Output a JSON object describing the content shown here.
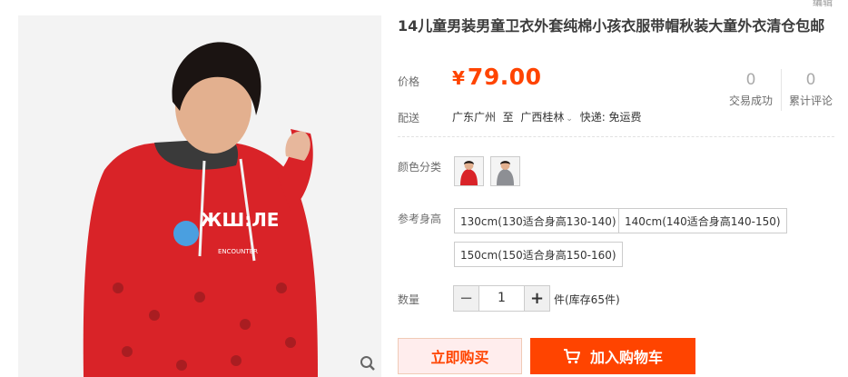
{
  "corner": "编辑",
  "title": "14儿童男装男童卫衣外套纯棉小孩衣服带帽秋装大童外衣清仓包邮",
  "price": {
    "label": "价格",
    "currency": "¥",
    "value": "79.00"
  },
  "stats": [
    {
      "count": "0",
      "label": "交易成功"
    },
    {
      "count": "0",
      "label": "累计评论"
    }
  ],
  "shipping": {
    "label": "配送",
    "from": "广东广州",
    "to_word": "至",
    "to": "广西桂林",
    "fee": "快递: 免运费"
  },
  "color": {
    "label": "颜色分类"
  },
  "size": {
    "label": "参考身高",
    "options": [
      "130cm(130适合身高130-140)",
      "140cm(140适合身高140-150)",
      "150cm(150适合身高150-160)"
    ]
  },
  "quantity": {
    "label": "数量",
    "value": "1",
    "minus": "−",
    "plus": "+",
    "stock": "件(库存65件)"
  },
  "buttons": {
    "buy_now": "立即购买",
    "add_cart": "加入购物车"
  },
  "colors": {
    "accent": "#ff4400",
    "buy_bg": "#ffeded",
    "price": "#ff4400"
  }
}
